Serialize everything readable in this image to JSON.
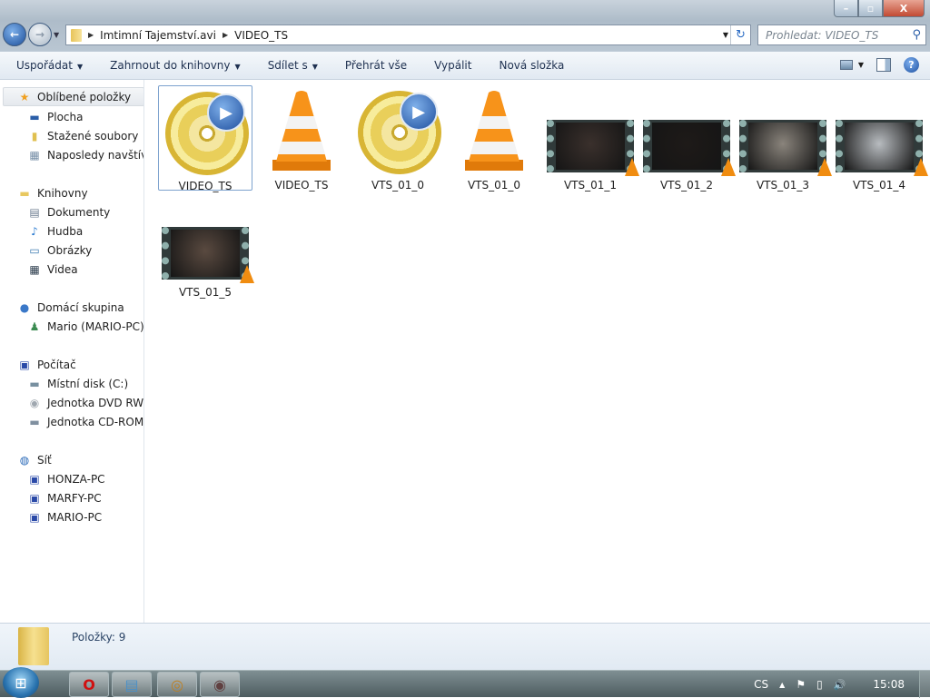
{
  "window": {
    "controls": {
      "minimize": "–",
      "maximize": "▫",
      "close": "X"
    }
  },
  "nav": {
    "back": "←",
    "forward": "→"
  },
  "address": {
    "crumbs": [
      "Imtimní Tajemství.avi",
      "VIDEO_TS"
    ],
    "refresh": "↻"
  },
  "search": {
    "placeholder": "Prohledat: VIDEO_TS",
    "icon": "⚲"
  },
  "toolbar": {
    "items": [
      {
        "label": "Uspořádat",
        "dropdown": true
      },
      {
        "label": "Zahrnout do knihovny",
        "dropdown": true
      },
      {
        "label": "Sdílet s",
        "dropdown": true
      },
      {
        "label": "Přehrát vše",
        "dropdown": false
      },
      {
        "label": "Vypálit",
        "dropdown": false
      },
      {
        "label": "Nová složka",
        "dropdown": false
      }
    ],
    "help": "?"
  },
  "sidebar": {
    "items": [
      {
        "label": "Oblíbené položky",
        "icon": "star-icon",
        "glyph": "★",
        "color": "#f0a020",
        "level": 0,
        "selected": true
      },
      {
        "label": "Plocha",
        "icon": "desktop-icon",
        "glyph": "▬",
        "color": "#2a5ea8",
        "level": 1
      },
      {
        "label": "Stažené soubory",
        "icon": "downloads-folder-icon",
        "glyph": "▮",
        "color": "#e0c050",
        "level": 1
      },
      {
        "label": "Naposledy navštívené",
        "icon": "recent-places-icon",
        "glyph": "▦",
        "color": "#7890a8",
        "level": 1
      },
      {
        "label": "Knihovny",
        "icon": "libraries-icon",
        "glyph": "▬",
        "color": "#e8c860",
        "level": 0,
        "gap": true
      },
      {
        "label": "Dokumenty",
        "icon": "documents-icon",
        "glyph": "▤",
        "color": "#6c7c90",
        "level": 1
      },
      {
        "label": "Hudba",
        "icon": "music-icon",
        "glyph": "♪",
        "color": "#2a7ad0",
        "level": 1
      },
      {
        "label": "Obrázky",
        "icon": "pictures-icon",
        "glyph": "▭",
        "color": "#3a7ab0",
        "level": 1
      },
      {
        "label": "Videa",
        "icon": "videos-icon",
        "glyph": "▦",
        "color": "#304050",
        "level": 1
      },
      {
        "label": "Domácí skupina",
        "icon": "homegroup-icon",
        "glyph": "●",
        "color": "#3a78c8",
        "level": 0,
        "gap": true
      },
      {
        "label": "Mario (MARIO-PC)",
        "icon": "user-icon",
        "glyph": "♟",
        "color": "#3a8a50",
        "level": 1
      },
      {
        "label": "Počítač",
        "icon": "computer-icon",
        "glyph": "▣",
        "color": "#2a4aa8",
        "level": 0,
        "gap": true
      },
      {
        "label": "Místní disk (C:)",
        "icon": "local-disk-icon",
        "glyph": "▬",
        "color": "#7890a0",
        "level": 1
      },
      {
        "label": "Jednotka DVD RW (D:)",
        "icon": "dvd-drive-icon",
        "glyph": "◉",
        "color": "#a0a8b0",
        "level": 1
      },
      {
        "label": "Jednotka CD-ROM (E:)",
        "icon": "cdrom-drive-icon",
        "glyph": "▬",
        "color": "#8090a0",
        "level": 1
      },
      {
        "label": "Síť",
        "icon": "network-icon",
        "glyph": "◍",
        "color": "#2a6ab8",
        "level": 0,
        "gap": true
      },
      {
        "label": "HONZA-PC",
        "icon": "computer-icon",
        "glyph": "▣",
        "color": "#2a4aa8",
        "level": 1
      },
      {
        "label": "MARFY-PC",
        "icon": "computer-icon",
        "glyph": "▣",
        "color": "#2a4aa8",
        "level": 1
      },
      {
        "label": "MARIO-PC",
        "icon": "computer-icon",
        "glyph": "▣",
        "color": "#2a4aa8",
        "level": 1
      }
    ]
  },
  "files": [
    {
      "name": "VIDEO_TS",
      "type": "dvd",
      "selected": true
    },
    {
      "name": "VIDEO_TS",
      "type": "vlc"
    },
    {
      "name": "VTS_01_0",
      "type": "dvd"
    },
    {
      "name": "VTS_01_0",
      "type": "vlc"
    },
    {
      "name": "VTS_01_1",
      "type": "video",
      "tint": "#3a302c"
    },
    {
      "name": "VTS_01_2",
      "type": "video",
      "tint": "#1e1a18"
    },
    {
      "name": "VTS_01_3",
      "type": "video",
      "tint": "#8a847c"
    },
    {
      "name": "VTS_01_4",
      "type": "video",
      "tint": "#b8bcc0"
    },
    {
      "name": "VTS_01_5",
      "type": "video",
      "tint": "#5a4a40"
    }
  ],
  "status": {
    "count": "Položky: 9"
  },
  "taskbar": {
    "apps": [
      {
        "name": "opera",
        "glyph": "O",
        "color": "#d01010"
      },
      {
        "name": "explorer",
        "glyph": "▤",
        "color": "#4a90c8"
      },
      {
        "name": "app-3",
        "glyph": "◎",
        "color": "#c08020"
      },
      {
        "name": "app-4",
        "glyph": "◉",
        "color": "#604040"
      }
    ],
    "language": "CS",
    "tray_arrow": "▲",
    "flag": "⚑",
    "network": "▯",
    "volume": "🔊",
    "clock": "15:08"
  }
}
